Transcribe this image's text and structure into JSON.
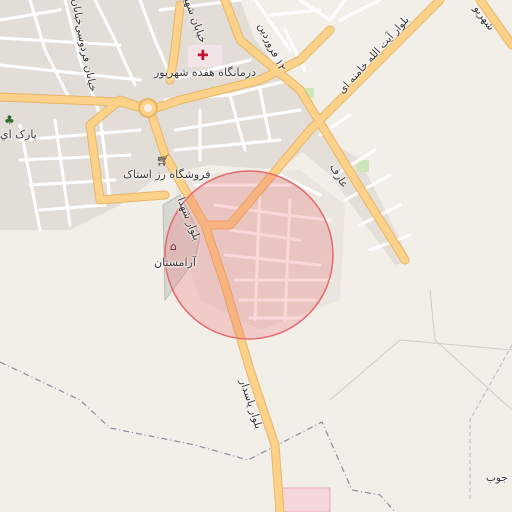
{
  "map": {
    "colors": {
      "background": "#f2efe9",
      "primary_road": "#fcd18a",
      "primary_casing": "#e8b565",
      "street": "#ffffff",
      "street_casing": "#cfcac2",
      "built_area": "#e2ddd6",
      "cemetery": "#d8d8d3",
      "hospital": "#f5d7dc",
      "park": "#cde5b8",
      "boundary": "#8f8a9a",
      "circle_fill": "rgba(236,94,100,0.25)",
      "circle_stroke": "#e36a70"
    },
    "pois": {
      "hospital": {
        "label": "درمانگاه هفده شهریور",
        "icon": "hospital-cross-icon"
      },
      "shop": {
        "label": "فروشگاه رز استاک",
        "icon": "shopping-cart-icon"
      },
      "cemetery": {
        "label": "آرامستان",
        "icon": "cemetery-icon"
      },
      "park": {
        "label": "پارک اي",
        "icon": "tree-icon"
      }
    },
    "roads": {
      "shohada": "بلوار شهدا",
      "pasdar": "بلوار پاسدار",
      "khamenei": "بلوار آیت الله خامنه ای",
      "ferdowsi": "خیابان فردوسی",
      "shahid": "خیابان شهید",
      "khayaban": "خیابان",
      "farvardin": "۱۲ فروردین",
      "aref": "عارف",
      "shahrivar": "شهریو",
      "jub": "جوب"
    }
  }
}
